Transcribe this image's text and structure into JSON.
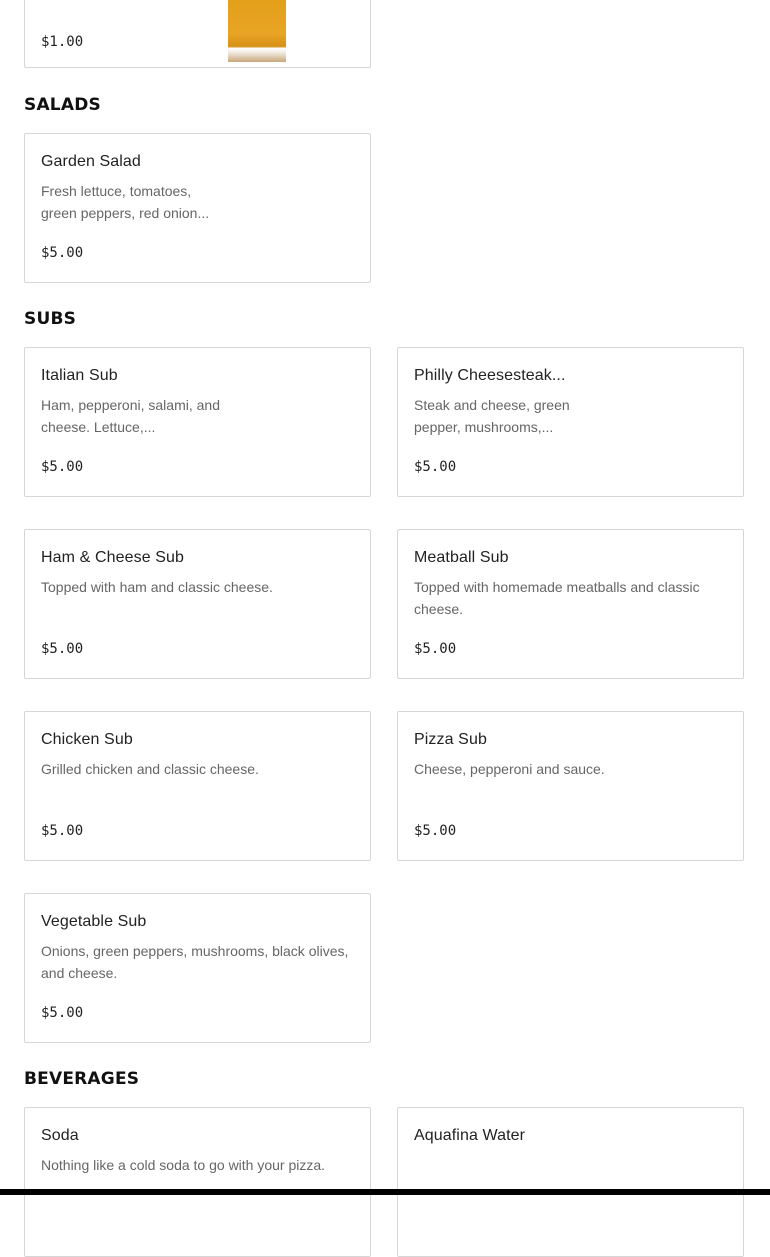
{
  "top_item": {
    "price": "$1.00"
  },
  "sections": {
    "salads": {
      "title": "SALADS"
    },
    "subs": {
      "title": "SUBS"
    },
    "beverages": {
      "title": "BEVERAGES"
    }
  },
  "items": {
    "garden_salad": {
      "name": "Garden Salad",
      "description": "Fresh lettuce, tomatoes, green peppers, red onion...",
      "price": "$5.00"
    },
    "italian_sub": {
      "name": "Italian Sub",
      "description": "Ham, pepperoni, salami, and cheese. Lettuce,...",
      "price": "$5.00"
    },
    "philly_cheesesteak": {
      "name": "Philly Cheesesteak...",
      "description": "Steak and cheese, green pepper, mushrooms,...",
      "price": "$5.00"
    },
    "ham_cheese_sub": {
      "name": "Ham & Cheese Sub",
      "description": "Topped with ham and classic cheese.",
      "price": "$5.00"
    },
    "meatball_sub": {
      "name": "Meatball Sub",
      "description": "Topped with homemade meatballs and classic cheese.",
      "price": "$5.00"
    },
    "chicken_sub": {
      "name": "Chicken Sub",
      "description": "Grilled chicken and classic cheese.",
      "price": "$5.00"
    },
    "pizza_sub": {
      "name": "Pizza Sub",
      "description": "Cheese, pepperoni and sauce.",
      "price": "$5.00"
    },
    "vegetable_sub": {
      "name": "Vegetable Sub",
      "description": "Onions, green peppers, mushrooms, black olives, and cheese.",
      "price": "$5.00"
    },
    "soda": {
      "name": "Soda",
      "description": "Nothing like a cold soda to go with your pizza."
    },
    "aquafina_water": {
      "name": "Aquafina Water"
    }
  }
}
